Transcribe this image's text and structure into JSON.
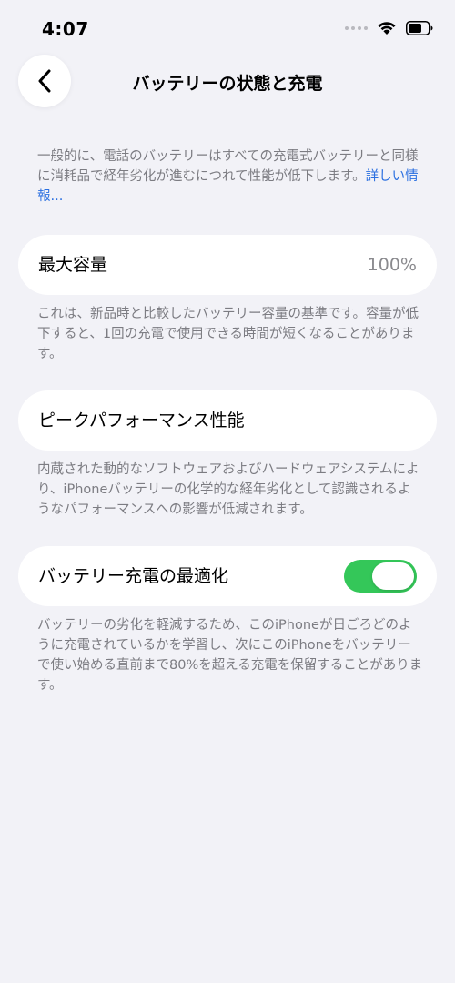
{
  "status_bar": {
    "time": "4:07"
  },
  "nav": {
    "title": "バッテリーの状態と充電"
  },
  "intro": {
    "text": "一般的に、電話のバッテリーはすべての充電式バッテリーと同様に消耗品で経年劣化が進むにつれて性能が低下します。",
    "link": "詳しい情報..."
  },
  "max_capacity": {
    "label": "最大容量",
    "value": "100%",
    "description": "これは、新品時と比較したバッテリー容量の基準です。容量が低下すると、1回の充電で使用できる時間が短くなることがあります。"
  },
  "peak_performance": {
    "label": "ピークパフォーマンス性能",
    "description": "内蔵された動的なソフトウェアおよびハードウェアシステムにより、iPhoneバッテリーの化学的な経年劣化として認識されるようなパフォーマンスへの影響が低減されます。"
  },
  "optimized_charging": {
    "label": "バッテリー充電の最適化",
    "enabled": true,
    "description": "バッテリーの劣化を軽減するため、このiPhoneが日ごろどのように充電されているかを学習し、次にこのiPhoneをバッテリーで使い始める直前まで80%を超える充電を保留することがあります。"
  },
  "colors": {
    "background": "#f2f2f7",
    "link": "#2a6fe0",
    "toggle_on": "#34c759",
    "secondary_text": "#7c7c82"
  },
  "icons": {
    "back": "chevron-left-icon",
    "wifi": "wifi-icon",
    "battery": "battery-icon",
    "signal": "signal-icon"
  }
}
